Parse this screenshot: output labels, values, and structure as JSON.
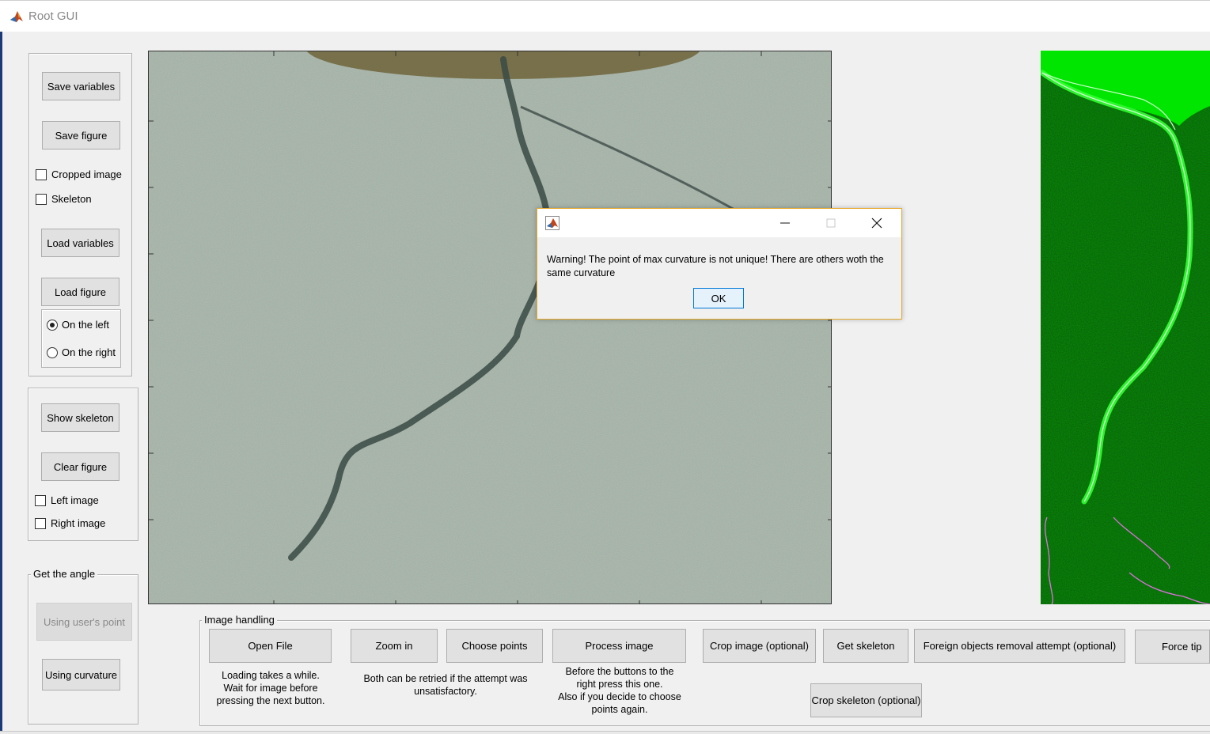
{
  "window": {
    "title": "Root GUI",
    "icon": "matlab-icon"
  },
  "left_panel": {
    "save_variables": "Save variables",
    "save_figure": "Save figure",
    "cropped_image": "Cropped image",
    "skeleton": "Skeleton",
    "load_variables": "Load variables",
    "load_figure": "Load figure",
    "on_the_left": "On the left",
    "on_the_right": "On the right",
    "selected_side": "On the left"
  },
  "skeleton_panel": {
    "show_skeleton": "Show skeleton",
    "clear_figure": "Clear figure",
    "left_image": "Left image",
    "right_image": "Right image"
  },
  "angle_panel": {
    "title": "Get the angle",
    "using_users_point": "Using user's point",
    "using_curvature": "Using curvature"
  },
  "image_handling": {
    "title": "Image handling",
    "open_file": "Open File",
    "open_file_note": "Loading takes a while.\nWait for  image before\npressing the next button.",
    "zoom_in": "Zoom in",
    "choose_points": "Choose points",
    "retry_note": "Both can be retried if the attempt was\nunsatisfactory.",
    "process_image": "Process image",
    "process_note": "Before the buttons to the\nright press this one.\nAlso if you decide to choose\npoints again.",
    "crop_image": "Crop image (optional)",
    "get_skeleton": "Get skeleton",
    "foreign_objects": "Foreign objects removal attempt (optional)",
    "force_tip": "Force tip",
    "crop_skeleton": "Crop skeleton (optional)"
  },
  "dialog": {
    "message": "Warning! The point of max curvature is not unique! There are others woth the same curvature",
    "ok": "OK"
  },
  "colors": {
    "dialog_border": "#e6a92b",
    "focus_blue": "#0078d7",
    "photo_bg": "#9fada0",
    "green_bg": "#0a5a0a"
  }
}
